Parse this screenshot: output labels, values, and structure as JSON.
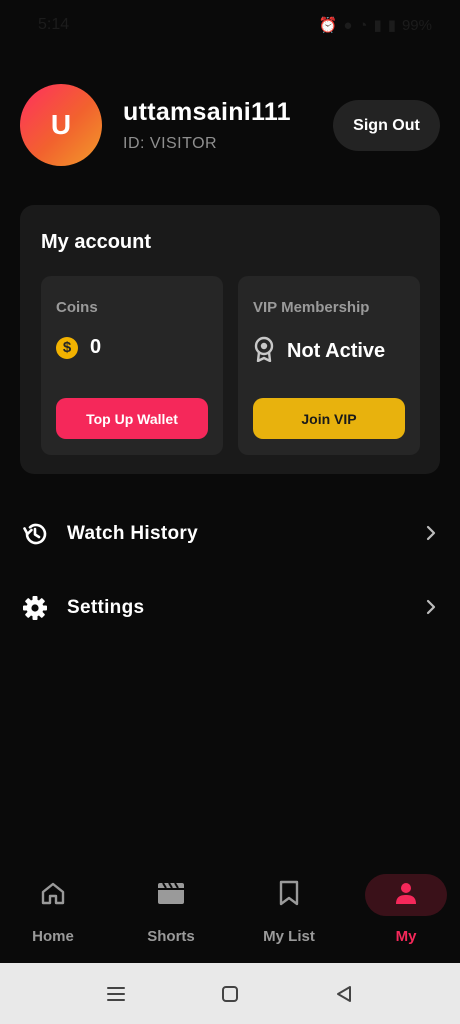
{
  "status_bar": {
    "time": "5:14",
    "battery": "99%"
  },
  "profile": {
    "avatar_letter": "U",
    "username": "uttamsaini111",
    "user_id": "ID: VISITOR",
    "sign_out_label": "Sign Out"
  },
  "account": {
    "title": "My account",
    "coins": {
      "label": "Coins",
      "icon": "dollar-coin-icon",
      "value": "0",
      "button_label": "Top Up Wallet"
    },
    "vip": {
      "label": "VIP Membership",
      "icon": "award-badge-icon",
      "value": "Not Active",
      "button_label": "Join VIP"
    }
  },
  "menu": {
    "items": [
      {
        "label": "Watch History",
        "icon": "history-icon"
      },
      {
        "label": "Settings",
        "icon": "gear-icon"
      }
    ]
  },
  "bottom_nav": {
    "items": [
      {
        "label": "Home",
        "icon": "home-icon"
      },
      {
        "label": "Shorts",
        "icon": "clapperboard-icon"
      },
      {
        "label": "My List",
        "icon": "bookmark-icon"
      },
      {
        "label": "My",
        "icon": "person-icon"
      }
    ],
    "active_index": 3
  },
  "colors": {
    "background": "#0a0a0a",
    "accent": "#f5285a",
    "vip_gold": "#e8b20d",
    "card": "#1a1a1a",
    "tile": "#262626"
  }
}
